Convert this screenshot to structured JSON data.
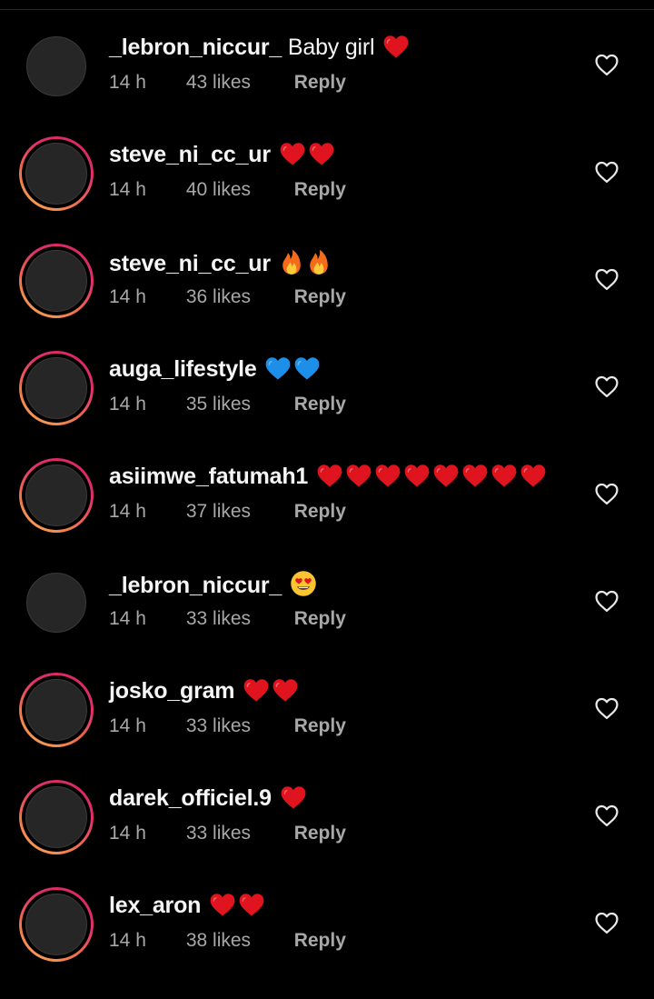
{
  "comments": [
    {
      "username": "_lebron_niccur_",
      "text": "Baby girl",
      "emojis": [
        "red-heart"
      ],
      "time": "14 h",
      "likes": "43 likes",
      "reply": "Reply",
      "story": false
    },
    {
      "username": "steve_ni_cc_ur",
      "text": "",
      "emojis": [
        "red-heart",
        "red-heart"
      ],
      "time": "14 h",
      "likes": "40 likes",
      "reply": "Reply",
      "story": true
    },
    {
      "username": "steve_ni_cc_ur",
      "text": "",
      "emojis": [
        "fire",
        "fire"
      ],
      "time": "14 h",
      "likes": "36 likes",
      "reply": "Reply",
      "story": true
    },
    {
      "username": "auga_lifestyle",
      "text": "",
      "emojis": [
        "blue-heart",
        "blue-heart"
      ],
      "time": "14 h",
      "likes": "35 likes",
      "reply": "Reply",
      "story": true
    },
    {
      "username": "asiimwe_fatumah1",
      "text": "",
      "emojis": [
        "red-heart",
        "red-heart",
        "red-heart",
        "red-heart",
        "red-heart",
        "red-heart",
        "red-heart",
        "red-heart"
      ],
      "time": "14 h",
      "likes": "37 likes",
      "reply": "Reply",
      "story": true
    },
    {
      "username": "_lebron_niccur_",
      "text": "",
      "emojis": [
        "heart-eyes-face"
      ],
      "time": "14 h",
      "likes": "33 likes",
      "reply": "Reply",
      "story": false
    },
    {
      "username": "josko_gram",
      "text": "",
      "emojis": [
        "red-heart",
        "red-heart"
      ],
      "time": "14 h",
      "likes": "33 likes",
      "reply": "Reply",
      "story": true
    },
    {
      "username": "darek_officiel.9",
      "text": "",
      "emojis": [
        "red-heart"
      ],
      "time": "14 h",
      "likes": "33 likes",
      "reply": "Reply",
      "story": true
    },
    {
      "username": "lex_aron",
      "text": "",
      "emojis": [
        "red-heart",
        "red-heart"
      ],
      "time": "14 h",
      "likes": "38 likes",
      "reply": "Reply",
      "story": true
    }
  ],
  "colors": {
    "background": "#000000",
    "text": "#f5f5f5",
    "meta": "#a8a8a8",
    "heart_red": "#e0141e",
    "heart_blue": "#1d8fe8",
    "story_ring_start": "#d7265c",
    "story_ring_end": "#fbb35a"
  },
  "icons": {
    "like": "heart-outline-icon",
    "avatar": "avatar"
  }
}
